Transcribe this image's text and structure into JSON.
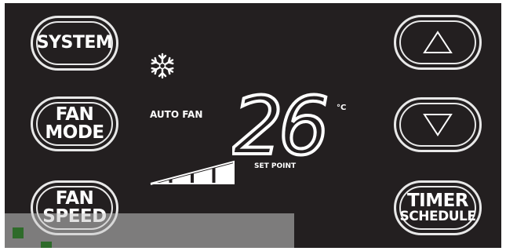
{
  "buttons": {
    "system": "SYSTEM",
    "fan_mode_line1": "FAN",
    "fan_mode_line2": "MODE",
    "fan_speed_line1": "FAN",
    "fan_speed_line2": "SPEED",
    "timer_line1": "TIMER",
    "timer_line2": "SCHEDULE"
  },
  "display": {
    "mode_icon": "snowflake-icon",
    "fan_status": "AUTO FAN",
    "temperature": "26",
    "unit": "°C",
    "setpoint_label": "SET POINT",
    "fan_speed_level": 1.0
  },
  "colors": {
    "panel": "#231f20",
    "foreground": "#ffffff"
  }
}
